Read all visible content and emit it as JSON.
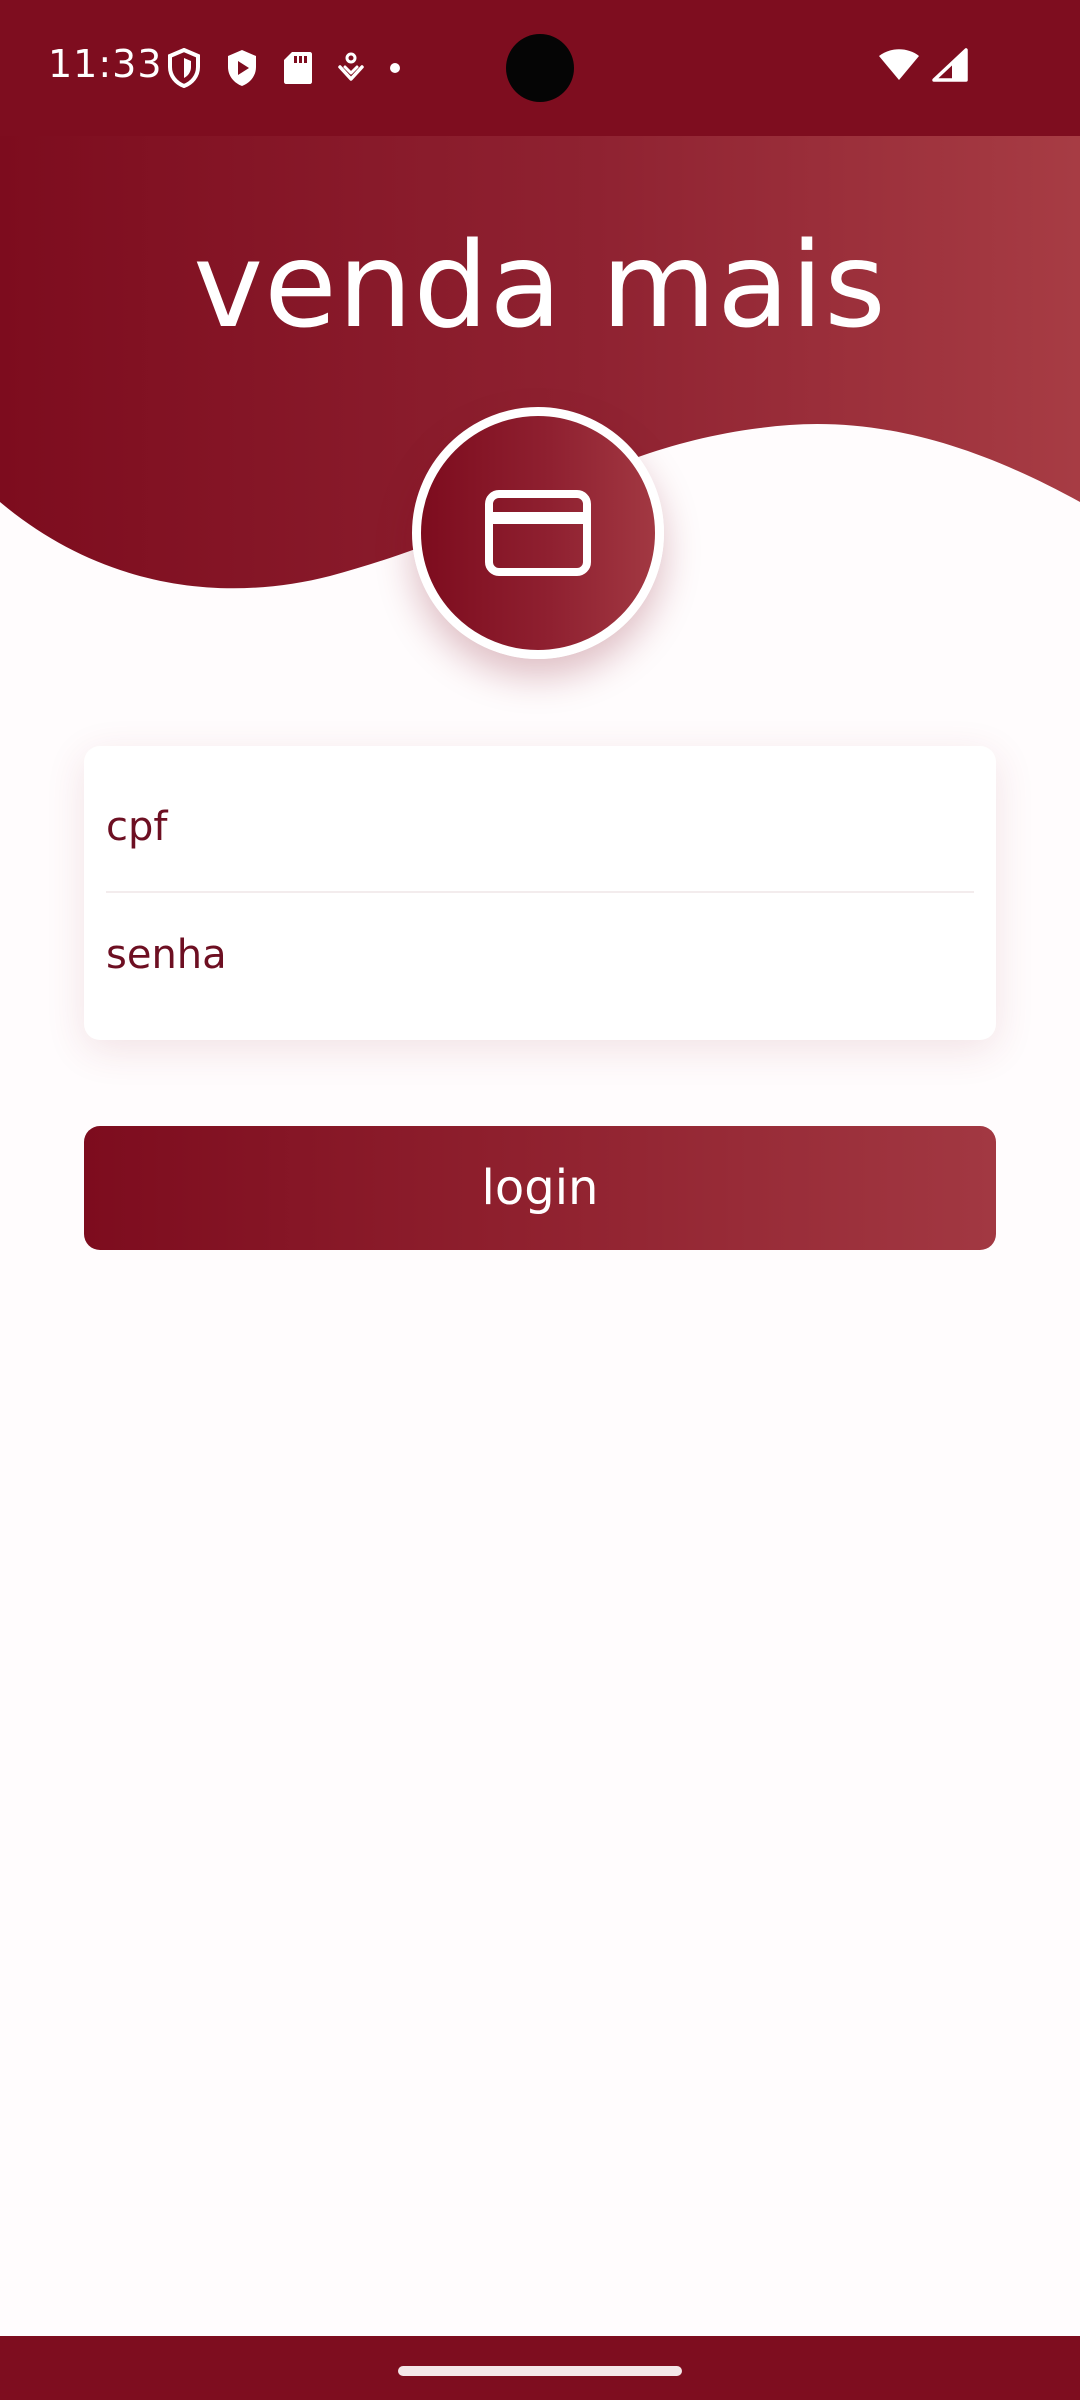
{
  "status_bar": {
    "time": "11:33"
  },
  "app": {
    "title": "venda mais",
    "logo_icon": "credit-card-icon"
  },
  "login_form": {
    "cpf_placeholder": "cpf",
    "password_placeholder": "senha",
    "login_label": "login"
  },
  "colors": {
    "brand_dark": "#7e0d1f",
    "brand_light": "#a23842",
    "text_accent": "#6d0f22"
  }
}
